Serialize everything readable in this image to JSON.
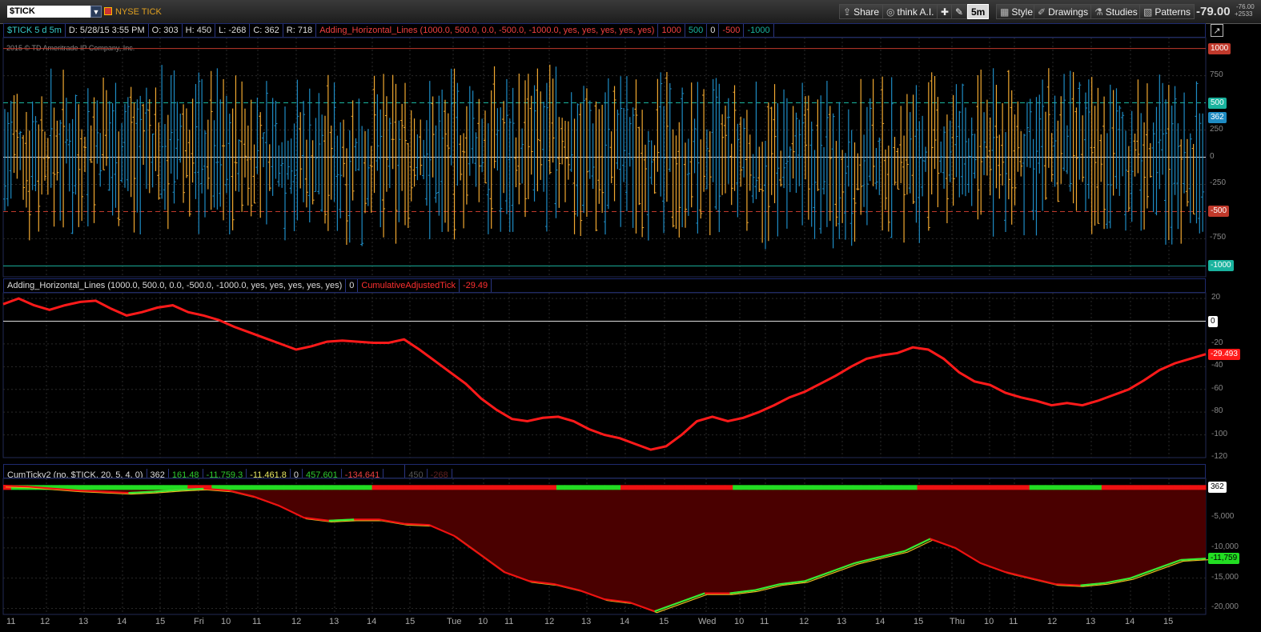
{
  "toolbar": {
    "symbol": "$TICK",
    "symbol_name": "NYSE TICK",
    "share": "Share",
    "think": "think A.I.",
    "timeframe": "5m",
    "style": "Style",
    "drawings": "Drawings",
    "studies": "Studies",
    "patterns": "Patterns",
    "last_price": "-79.00",
    "change_top": "-76.00",
    "change_bottom": "+2533"
  },
  "panel1": {
    "title": "$TICK 5 d 5m",
    "date": "D: 5/28/15 3:55 PM",
    "open": "O: 303",
    "high": "H: 450",
    "low": "L: -268",
    "close": "C: 362",
    "range": "R: 718",
    "study": "Adding_Horizontal_Lines (1000.0, 500.0, 0.0, -500.0, -1000.0, yes, yes, yes, yes, yes)",
    "v1": "1000",
    "v2": "500",
    "v3": "0",
    "v4": "-500",
    "v5": "-1000",
    "watermark": "2015 © TD Ameritrade IP Company, Inc.",
    "axis": [
      "1000",
      "750",
      "500",
      "250",
      "0",
      "-250",
      "-500",
      "-750",
      "-1000"
    ],
    "price_tags": [
      "1000",
      "500",
      "362",
      "-500",
      "-1000"
    ]
  },
  "panel2": {
    "study": "Adding_Horizontal_Lines (1000.0, 500.0, 0.0, -500.0, -1000.0, yes, yes, yes, yes, yes)",
    "v0": "0",
    "study2": "CumulativeAdjustedTick",
    "v2": "-29.49",
    "axis": [
      "20",
      "0",
      "-20",
      "-40",
      "-60",
      "-80",
      "-100",
      "-120"
    ],
    "tags": [
      "0",
      "-29.493"
    ]
  },
  "panel3": {
    "study": "CumTickv2 (no, $TICK, 20, 5, 4, 0)",
    "v1": "362",
    "v2": "161.48",
    "v3": "-11,759.3",
    "v4": "-11,461.8",
    "v5": "0",
    "v6": "457.601",
    "v7": "-134.641",
    "v8": "",
    "v9": "450",
    "v10": "-268",
    "axis": [
      "-5,000",
      "-10,000",
      "-15,000",
      "-20,000"
    ],
    "tags": [
      "362",
      "-11,759"
    ]
  },
  "xaxis": [
    "11",
    "12",
    "13",
    "14",
    "15",
    "Fri",
    "10",
    "11",
    "12",
    "13",
    "14",
    "15",
    "Tue",
    "10",
    "11",
    "12",
    "13",
    "14",
    "15",
    "Wed",
    "10",
    "11",
    "12",
    "13",
    "14",
    "15",
    "Thu",
    "10",
    "11",
    "12",
    "13",
    "14",
    "15"
  ],
  "colors": {
    "up_bar": "#1e8bc3",
    "down_bar": "#f0a830",
    "cum_line": "#ff1a1a",
    "fill": "#4a0000",
    "accent": "#19b39e"
  },
  "chart_data": [
    {
      "type": "bar",
      "title": "$TICK 5 d 5m",
      "ylim": [
        -1100,
        1100
      ],
      "reference_lines": [
        1000,
        500,
        0,
        -500,
        -1000
      ],
      "last": {
        "open": 303,
        "high": 450,
        "low": -268,
        "close": 362
      }
    },
    {
      "type": "line",
      "title": "CumulativeAdjustedTick",
      "ylim": [
        -120,
        25
      ],
      "series": [
        {
          "name": "CumulativeAdjustedTick",
          "values": [
            15,
            20,
            14,
            10,
            14,
            17,
            18,
            11,
            5,
            8,
            12,
            14,
            8,
            5,
            1,
            -5,
            -10,
            -15,
            -20,
            -25,
            -22,
            -18,
            -17,
            -18,
            -19,
            -19,
            -16,
            -25,
            -35,
            -45,
            -55,
            -68,
            -78,
            -86,
            -88,
            -85,
            -84,
            -88,
            -95,
            -100,
            -103,
            -108,
            -113,
            -110,
            -100,
            -88,
            -84,
            -88,
            -85,
            -80,
            -74,
            -67,
            -62,
            -55,
            -48,
            -40,
            -33,
            -30,
            -28,
            -23,
            -25,
            -33,
            -45,
            -53,
            -56,
            -63,
            -67,
            -70,
            -74,
            -72,
            -74,
            -70,
            -65,
            -60,
            -52,
            -43,
            -37,
            -33,
            -29
          ]
        }
      ]
    },
    {
      "type": "area",
      "title": "CumTickv2",
      "ylim": [
        -21000,
        1500
      ],
      "series": [
        {
          "name": "CumTickv2",
          "values": [
            300,
            150,
            -200,
            -500,
            -700,
            -900,
            -700,
            -400,
            -200,
            -500,
            -1500,
            -3000,
            -5000,
            -5500,
            -5300,
            -5300,
            -6000,
            -6200,
            -8000,
            -11000,
            -14000,
            -15500,
            -16000,
            -17000,
            -18500,
            -19000,
            -20500,
            -19000,
            -17500,
            -17500,
            -17000,
            -16000,
            -15500,
            -14000,
            -12500,
            -11500,
            -10500,
            -8500,
            -10000,
            -12500,
            -14000,
            -15000,
            -16000,
            -16200,
            -15800,
            -15000,
            -13500,
            -12000,
            -11759
          ]
        }
      ]
    }
  ]
}
